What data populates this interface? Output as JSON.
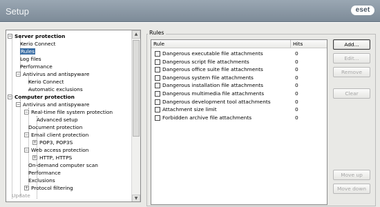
{
  "window": {
    "title": "Setup",
    "brand": "eset"
  },
  "tree": {
    "nodes": [
      {
        "label": "Server protection",
        "expander": "−",
        "bold": true
      },
      {
        "label": "Kerio Connect"
      },
      {
        "label": "Rules",
        "selected": true
      },
      {
        "label": "Log files"
      },
      {
        "label": "Performance"
      },
      {
        "label": "Antivirus and antispyware",
        "expander": "−"
      },
      {
        "label": "Kerio Connect"
      },
      {
        "label": "Automatic exclusions"
      },
      {
        "label": "Computer protection",
        "expander": "−",
        "bold": true
      },
      {
        "label": "Antivirus and antispyware",
        "expander": "−"
      },
      {
        "label": "Real-time file system protection",
        "expander": "−"
      },
      {
        "label": "Advanced setup"
      },
      {
        "label": "Document protection"
      },
      {
        "label": "Email client protection",
        "expander": "−"
      },
      {
        "label": "POP3, POP3S",
        "expander": "+"
      },
      {
        "label": "Web access protection",
        "expander": "−"
      },
      {
        "label": "HTTP, HTTPS",
        "expander": "+"
      },
      {
        "label": "On-demand computer scan"
      },
      {
        "label": "Performance"
      },
      {
        "label": "Exclusions"
      },
      {
        "label": "Protocol filtering",
        "expander": "+"
      },
      {
        "label": "Update",
        "dim": true
      }
    ]
  },
  "rules": {
    "group_label": "Rules",
    "columns": {
      "rule": "Rule",
      "hits": "Hits"
    },
    "rows": [
      {
        "name": "Dangerous executable file attachments",
        "hits": "0"
      },
      {
        "name": "Dangerous script file attachments",
        "hits": "0"
      },
      {
        "name": "Dangerous office suite file attachments",
        "hits": "0"
      },
      {
        "name": "Dangerous system file attachments",
        "hits": "0"
      },
      {
        "name": "Dangerous installation file attachments",
        "hits": "0"
      },
      {
        "name": "Dangerous multimedia file attachments",
        "hits": "0"
      },
      {
        "name": "Dangerous development tool attachments",
        "hits": "0"
      },
      {
        "name": "Attachment size limit",
        "hits": "0"
      },
      {
        "name": "Forbidden archive file attachments",
        "hits": "0"
      }
    ]
  },
  "buttons": {
    "add": "Add...",
    "edit": "Edit...",
    "remove": "Remove",
    "clear": "Clear",
    "move_up": "Move up",
    "move_down": "Move down"
  }
}
